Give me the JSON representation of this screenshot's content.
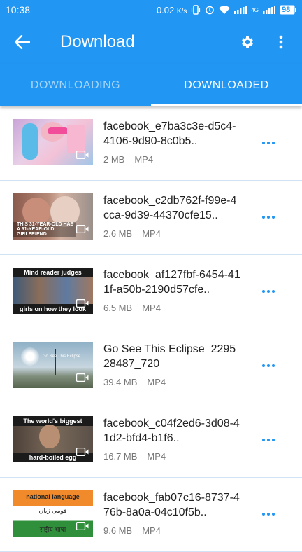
{
  "status": {
    "time": "10:38",
    "speed": "0.02",
    "speed_unit": "K/s",
    "network": "4G",
    "battery": "98"
  },
  "appbar": {
    "title": "Download",
    "icons": [
      "back-arrow-icon",
      "gear-icon",
      "more-vert-icon"
    ]
  },
  "tabs": [
    {
      "label": "DOWNLOADING",
      "active": false
    },
    {
      "label": "DOWNLOADED",
      "active": true
    }
  ],
  "items": [
    {
      "name": "facebook_e7ba3c3e-d5c4-4106-9d90-8c0b5..",
      "size": "2 MB",
      "format": "MP4",
      "thumb_text": ""
    },
    {
      "name": "facebook_c2db762f-f99e-4cca-9d39-44370cfe15..",
      "size": "2.6 MB",
      "format": "MP4",
      "thumb_text": "THIS 31-YEAR-OLD HAS A 91-YEAR-OLD GIRLFRIEND"
    },
    {
      "name": "facebook_af127fbf-6454-411f-a50b-2190d57cfe..",
      "size": "6.5 MB",
      "format": "MP4",
      "thumb_text_top": "Mind reader judges",
      "thumb_text_bottom": "girls on how they look"
    },
    {
      "name": "Go See This Eclipse_229528487_720",
      "size": "39.4 MB",
      "format": "MP4",
      "thumb_text": "Go See This Eclipse"
    },
    {
      "name": "facebook_c04f2ed6-3d08-41d2-bfd4-b1f6..",
      "size": "16.7 MB",
      "format": "MP4",
      "thumb_text_top": "The world's biggest",
      "thumb_text_bottom": "hard-boiled egg"
    },
    {
      "name": "facebook_fab07c16-8737-476b-8a0a-04c10f5b..",
      "size": "9.6 MB",
      "format": "MP4",
      "thumb_text_top": "national language",
      "thumb_text_mid": "قومی زبان",
      "thumb_text_bottom": "राष्ट्रीय भाषा"
    }
  ],
  "colors": {
    "primary": "#2196f3",
    "divider": "#cfe3f5"
  }
}
